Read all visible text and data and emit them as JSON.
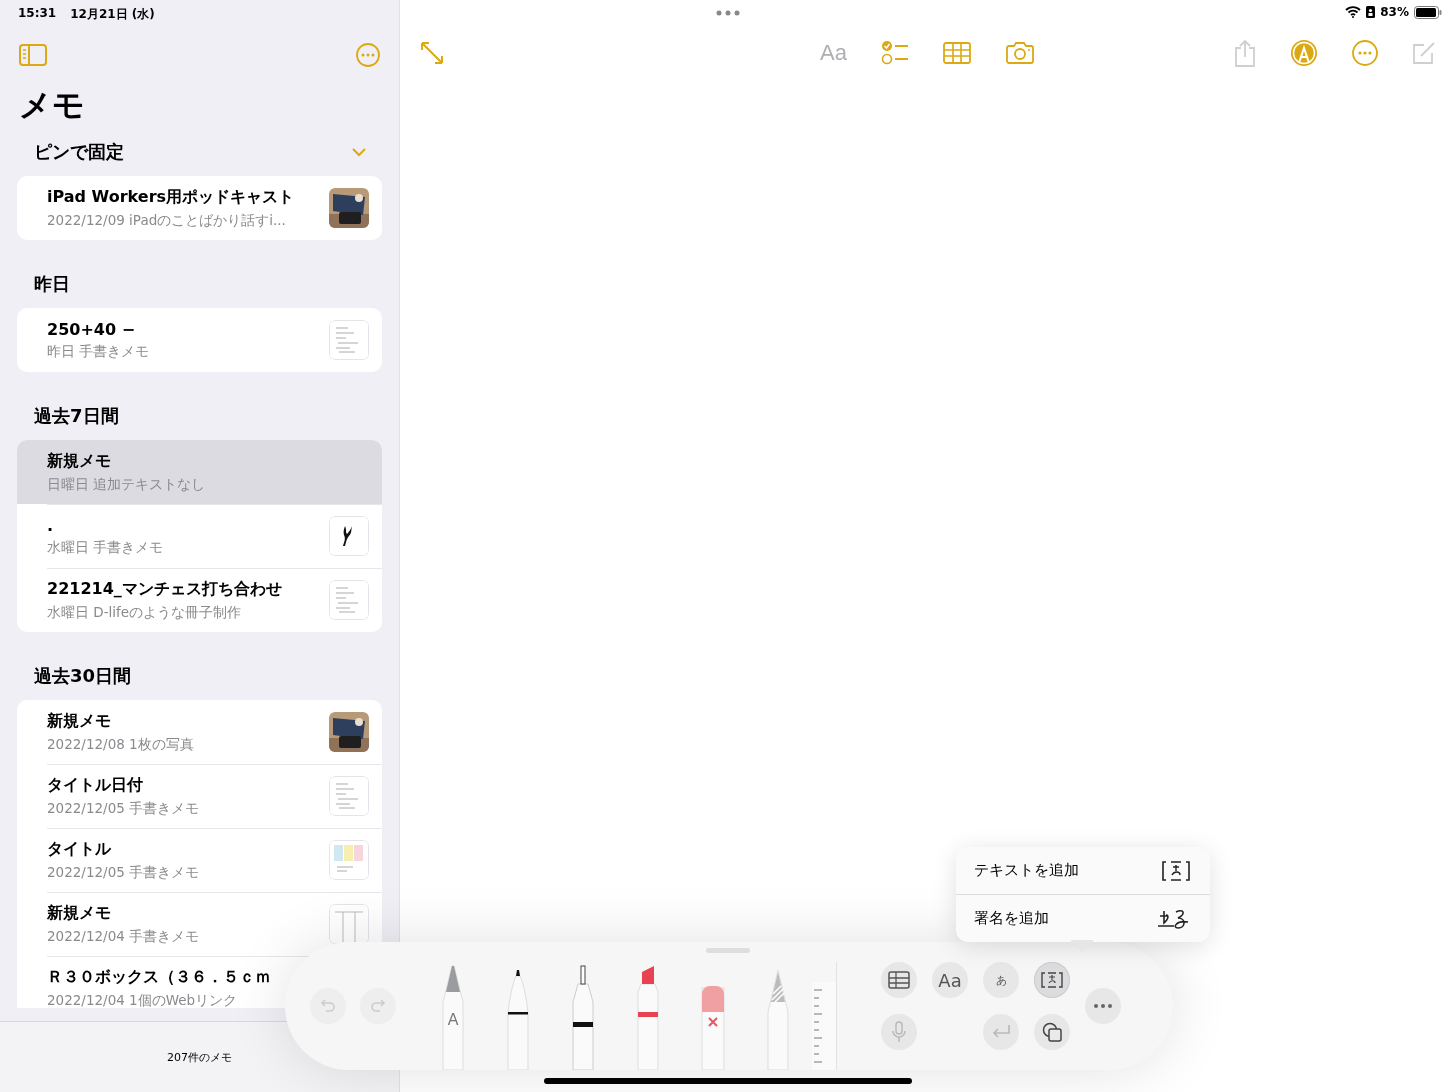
{
  "status_bar": {
    "time": "15:31",
    "date": "12月21日 (水)",
    "battery": "83%"
  },
  "sidebar": {
    "title": "メモ",
    "sections": [
      {
        "title": "ピンで固定",
        "expanded": true,
        "notes": [
          {
            "title": "iPad Workers用ポッドキャスト",
            "subtitle": "2022/12/09  iPadのことばかり話すi...",
            "selected": false
          }
        ]
      },
      {
        "title": "昨日",
        "notes": [
          {
            "title": "250+40 −",
            "subtitle": "昨日  手書きメモ",
            "selected": false,
            "thumbnail": {
              "kind": "sketch"
            }
          }
        ]
      },
      {
        "title": "過去7日間",
        "notes": [
          {
            "title": "新規メモ",
            "subtitle": "日曜日  追加テキストなし",
            "selected": true
          },
          {
            "title": ".",
            "subtitle": "水曜日  手書きメモ",
            "selected": false,
            "thumbnail": {
              "kind": "drawing"
            }
          },
          {
            "title": "221214_マンチェス打ち合わせ",
            "subtitle": "水曜日  D-lifeのような冊子制作",
            "selected": false,
            "thumbnail": {
              "kind": "sketch"
            }
          }
        ]
      },
      {
        "title": "過去30日間",
        "notes": [
          {
            "title": "新規メモ",
            "subtitle": "2022/12/08  1枚の写真",
            "selected": false
          },
          {
            "title": "タイトル日付",
            "subtitle": "2022/12/05  手書きメモ",
            "selected": false,
            "thumbnail": {
              "kind": "sketch"
            }
          },
          {
            "title": "タイトル",
            "subtitle": "2022/12/05  手書きメモ",
            "selected": false,
            "thumbnail": {
              "kind": "colorsketch"
            }
          },
          {
            "title": "新規メモ",
            "subtitle": "2022/12/04  手書きメモ",
            "selected": false,
            "thumbnail": {
              "kind": "table"
            }
          },
          {
            "title": "Ｒ３０ボックス（３６．５ｃｍ",
            "subtitle": "2022/12/04  1個のWebリンク",
            "selected": false
          }
        ]
      }
    ],
    "footer": "207件のメモ"
  },
  "toolbar": {
    "left": [
      {
        "kind": "expand",
        "disabled": false
      }
    ],
    "center": [
      {
        "kind": "format",
        "label": "Aa",
        "disabled": true
      },
      {
        "kind": "checklist",
        "disabled": false
      },
      {
        "kind": "table",
        "disabled": false
      },
      {
        "kind": "camera",
        "disabled": false
      }
    ],
    "right": [
      {
        "kind": "share",
        "disabled": true
      },
      {
        "kind": "markup",
        "disabled": false
      },
      {
        "kind": "more",
        "disabled": false
      },
      {
        "kind": "compose",
        "disabled": true
      }
    ]
  },
  "palette": {
    "undo": {
      "disabled": true
    },
    "redo": {
      "disabled": true
    },
    "tools": [
      {
        "kind": "monoline",
        "label": "A"
      },
      {
        "kind": "pen"
      },
      {
        "kind": "fineliner"
      },
      {
        "kind": "marker"
      },
      {
        "kind": "eraser"
      },
      {
        "kind": "pencil"
      },
      {
        "kind": "ruler"
      }
    ],
    "buttons": [
      {
        "kind": "table",
        "selected": false,
        "disabled": false
      },
      {
        "kind": "format",
        "label": "Aa",
        "selected": false,
        "disabled": false
      },
      {
        "kind": "kana",
        "label": "あ",
        "selected": false,
        "disabled": false
      },
      {
        "kind": "textbox",
        "selected": true,
        "disabled": false
      },
      {
        "kind": "mic",
        "selected": false,
        "disabled": true
      },
      {
        "kind": "return",
        "selected": false,
        "disabled": true
      },
      {
        "kind": "shapes",
        "selected": false,
        "disabled": false
      },
      {
        "kind": "more",
        "selected": false,
        "disabled": false
      }
    ]
  },
  "popover": {
    "items": [
      {
        "label": "テキストを追加",
        "kind": "text"
      },
      {
        "label": "署名を追加",
        "kind": "signature"
      }
    ]
  }
}
